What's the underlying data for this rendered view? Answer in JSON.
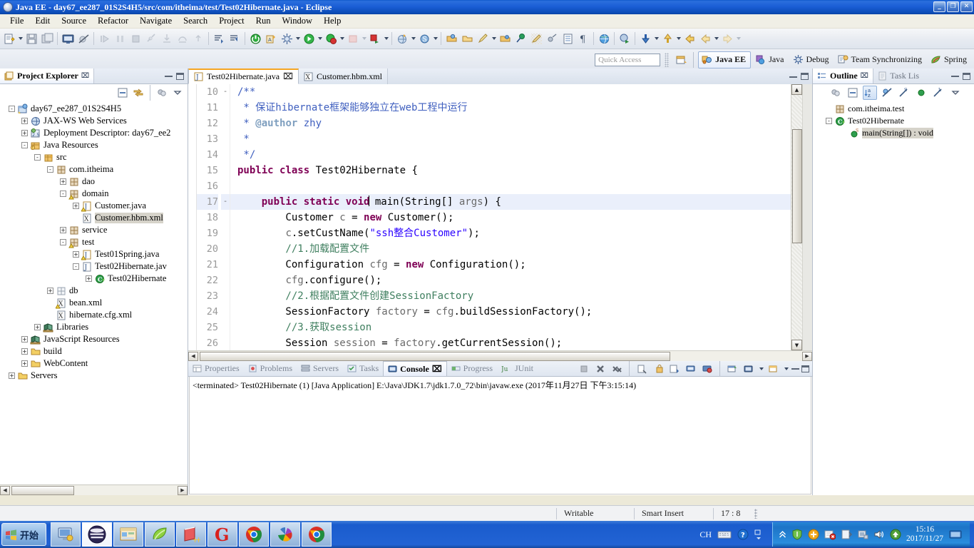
{
  "window": {
    "title": "Java EE - day67_ee287_01S2S4H5/src/com/itheima/test/Test02Hibernate.java - Eclipse",
    "minimize": "_",
    "restore": "❐",
    "close": "✕"
  },
  "menubar": {
    "items": [
      "File",
      "Edit",
      "Source",
      "Refactor",
      "Navigate",
      "Search",
      "Project",
      "Run",
      "Window",
      "Help"
    ]
  },
  "quick_access": {
    "placeholder": "Quick Access"
  },
  "perspectives": [
    {
      "label": "Java EE",
      "active": true
    },
    {
      "label": "Java",
      "active": false
    },
    {
      "label": "Debug",
      "active": false
    },
    {
      "label": "Team Synchronizing",
      "active": false
    },
    {
      "label": "Spring",
      "active": false
    }
  ],
  "project_explorer": {
    "tab_label": "Project Explorer",
    "close_glyph": "⌧",
    "tree": [
      {
        "indent": 0,
        "exp": "-",
        "icon": "project-icon",
        "label": "day67_ee287_01S2S4H5",
        "selected": false
      },
      {
        "indent": 1,
        "exp": "+",
        "icon": "jaxws-icon",
        "label": "JAX-WS Web Services",
        "selected": false
      },
      {
        "indent": 1,
        "exp": "+",
        "icon": "deployment-icon",
        "label": "Deployment Descriptor: day67_ee2",
        "selected": false
      },
      {
        "indent": 1,
        "exp": "-",
        "icon": "javaresources-icon",
        "label": "Java Resources",
        "selected": false
      },
      {
        "indent": 2,
        "exp": "-",
        "icon": "srcfolder-icon",
        "label": "src",
        "selected": false
      },
      {
        "indent": 3,
        "exp": "-",
        "icon": "package-icon",
        "label": "com.itheima",
        "selected": false
      },
      {
        "indent": 4,
        "exp": "+",
        "icon": "package-icon",
        "label": "dao",
        "selected": false
      },
      {
        "indent": 4,
        "exp": "-",
        "icon": "package-warn-icon",
        "label": "domain",
        "selected": false
      },
      {
        "indent": 5,
        "exp": "+",
        "icon": "java-warn-icon",
        "label": "Customer.java",
        "selected": false
      },
      {
        "indent": 5,
        "exp": "",
        "icon": "xml-icon",
        "label": "Customer.hbm.xml",
        "selected": true
      },
      {
        "indent": 4,
        "exp": "+",
        "icon": "package-icon",
        "label": "service",
        "selected": false
      },
      {
        "indent": 4,
        "exp": "-",
        "icon": "package-warn-icon",
        "label": "test",
        "selected": false
      },
      {
        "indent": 5,
        "exp": "+",
        "icon": "java-warn-icon",
        "label": "Test01Spring.java",
        "selected": false
      },
      {
        "indent": 5,
        "exp": "-",
        "icon": "java-icon",
        "label": "Test02Hibernate.jav",
        "selected": false
      },
      {
        "indent": 6,
        "exp": "+",
        "icon": "class-icon",
        "label": "Test02Hibernate",
        "selected": false
      },
      {
        "indent": 3,
        "exp": "+",
        "icon": "emptypkg-icon",
        "label": "db",
        "selected": false
      },
      {
        "indent": 3,
        "exp": "",
        "icon": "xml-warn-icon",
        "label": "bean.xml",
        "selected": false
      },
      {
        "indent": 3,
        "exp": "",
        "icon": "xml-icon",
        "label": "hibernate.cfg.xml",
        "selected": false
      },
      {
        "indent": 2,
        "exp": "+",
        "icon": "library-icon",
        "label": "Libraries",
        "selected": false
      },
      {
        "indent": 1,
        "exp": "+",
        "icon": "library-icon",
        "label": "JavaScript Resources",
        "selected": false
      },
      {
        "indent": 1,
        "exp": "+",
        "icon": "folder-icon",
        "label": "build",
        "selected": false
      },
      {
        "indent": 1,
        "exp": "+",
        "icon": "folder-icon",
        "label": "WebContent",
        "selected": false
      },
      {
        "indent": 0,
        "exp": "+",
        "icon": "folder-icon",
        "label": "Servers",
        "selected": false
      }
    ]
  },
  "editor": {
    "tabs": [
      {
        "label": "Test02Hibernate.java",
        "icon": "java-icon",
        "active": true,
        "close_glyph": "⌧"
      },
      {
        "label": "Customer.hbm.xml",
        "icon": "xml-icon",
        "active": false,
        "close_glyph": ""
      }
    ],
    "first_line_number": 10,
    "lines": [
      {
        "n": 10,
        "fold": "-",
        "hl": false,
        "tokens": [
          {
            "t": "/**",
            "c": "jdoc"
          }
        ]
      },
      {
        "n": 11,
        "fold": "",
        "hl": false,
        "tokens": [
          {
            "t": " * ",
            "c": "jdoc"
          },
          {
            "t": "保证hibernate框架能够独立在web工程中运行",
            "c": "jdoc"
          }
        ]
      },
      {
        "n": 12,
        "fold": "",
        "hl": false,
        "tokens": [
          {
            "t": " * ",
            "c": "jdoc"
          },
          {
            "t": "@author",
            "c": "jdoc-tag"
          },
          {
            "t": " zhy",
            "c": "jdoc"
          }
        ]
      },
      {
        "n": 13,
        "fold": "",
        "hl": false,
        "tokens": [
          {
            "t": " *",
            "c": "jdoc"
          }
        ]
      },
      {
        "n": 14,
        "fold": "",
        "hl": false,
        "tokens": [
          {
            "t": " */",
            "c": "jdoc"
          }
        ]
      },
      {
        "n": 15,
        "fold": "",
        "hl": false,
        "tokens": [
          {
            "t": "public class",
            "c": "kw"
          },
          {
            "t": " Test02Hibernate {",
            "c": ""
          }
        ]
      },
      {
        "n": 16,
        "fold": "",
        "hl": false,
        "tokens": [
          {
            "t": "",
            "c": ""
          }
        ]
      },
      {
        "n": 17,
        "fold": "-",
        "hl": true,
        "tokens": [
          {
            "t": "    ",
            "c": ""
          },
          {
            "t": "public static void",
            "c": "kw"
          },
          {
            "t": " main(String[] ",
            "c": ""
          },
          {
            "t": "args",
            "c": "local"
          },
          {
            "t": ") {",
            "c": ""
          }
        ]
      },
      {
        "n": 18,
        "fold": "",
        "hl": false,
        "tokens": [
          {
            "t": "        Customer ",
            "c": ""
          },
          {
            "t": "c",
            "c": "local"
          },
          {
            "t": " = ",
            "c": ""
          },
          {
            "t": "new",
            "c": "kw"
          },
          {
            "t": " Customer();",
            "c": ""
          }
        ]
      },
      {
        "n": 19,
        "fold": "",
        "hl": false,
        "tokens": [
          {
            "t": "        ",
            "c": ""
          },
          {
            "t": "c",
            "c": "local"
          },
          {
            "t": ".setCustName(",
            "c": ""
          },
          {
            "t": "\"ssh整合Customer\"",
            "c": "str"
          },
          {
            "t": ");",
            "c": ""
          }
        ]
      },
      {
        "n": 20,
        "fold": "",
        "hl": false,
        "tokens": [
          {
            "t": "        //1.加载配置文件",
            "c": "cmt"
          }
        ]
      },
      {
        "n": 21,
        "fold": "",
        "hl": false,
        "tokens": [
          {
            "t": "        Configuration ",
            "c": ""
          },
          {
            "t": "cfg",
            "c": "local"
          },
          {
            "t": " = ",
            "c": ""
          },
          {
            "t": "new",
            "c": "kw"
          },
          {
            "t": " Configuration();",
            "c": ""
          }
        ]
      },
      {
        "n": 22,
        "fold": "",
        "hl": false,
        "tokens": [
          {
            "t": "        ",
            "c": ""
          },
          {
            "t": "cfg",
            "c": "local"
          },
          {
            "t": ".configure();",
            "c": ""
          }
        ]
      },
      {
        "n": 23,
        "fold": "",
        "hl": false,
        "tokens": [
          {
            "t": "        //2.根据配置文件创建SessionFactory",
            "c": "cmt"
          }
        ]
      },
      {
        "n": 24,
        "fold": "",
        "hl": false,
        "tokens": [
          {
            "t": "        SessionFactory ",
            "c": ""
          },
          {
            "t": "factory",
            "c": "local"
          },
          {
            "t": " = ",
            "c": ""
          },
          {
            "t": "cfg",
            "c": "local"
          },
          {
            "t": ".buildSessionFactory();",
            "c": ""
          }
        ]
      },
      {
        "n": 25,
        "fold": "",
        "hl": false,
        "tokens": [
          {
            "t": "        //3.获取session",
            "c": "cmt"
          }
        ]
      },
      {
        "n": 26,
        "fold": "",
        "hl": false,
        "tokens": [
          {
            "t": "        Session ",
            "c": ""
          },
          {
            "t": "session",
            "c": "local"
          },
          {
            "t": " = ",
            "c": ""
          },
          {
            "t": "factory",
            "c": "local"
          },
          {
            "t": ".getCurrentSession();",
            "c": ""
          }
        ]
      }
    ]
  },
  "console": {
    "tabs": [
      {
        "label": "Properties",
        "icon": "properties-icon",
        "active": false
      },
      {
        "label": "Problems",
        "icon": "problems-icon",
        "active": false
      },
      {
        "label": "Servers",
        "icon": "servers-icon",
        "active": false
      },
      {
        "label": "Tasks",
        "icon": "tasks-icon",
        "active": false
      },
      {
        "label": "Console",
        "icon": "console-icon",
        "active": true,
        "close_glyph": "⌧"
      },
      {
        "label": "Progress",
        "icon": "progress-icon",
        "active": false
      },
      {
        "label": "JUnit",
        "icon": "junit-icon",
        "active": false
      }
    ],
    "output": "<terminated> Test02Hibernate (1) [Java Application] E:\\Java\\JDK1.7\\jdk1.7.0_72\\bin\\javaw.exe (2017年11月27日 下午3:15:14)"
  },
  "outline": {
    "tabs": [
      {
        "label": "Outline",
        "active": true,
        "close_glyph": "⌧"
      },
      {
        "label": "Task Lis",
        "active": false
      }
    ],
    "tree": [
      {
        "indent": 0,
        "exp": "",
        "icon": "package-icon",
        "label": "com.itheima.test",
        "selected": false
      },
      {
        "indent": 0,
        "exp": "-",
        "icon": "class-icon",
        "label": "Test02Hibernate",
        "selected": false
      },
      {
        "indent": 1,
        "exp": "",
        "icon": "method-static-icon",
        "label": "main(String[]) : void",
        "selected": true
      }
    ]
  },
  "statusbar": {
    "writable": "Writable",
    "insert_mode": "Smart Insert",
    "position": "17 : 8"
  },
  "taskbar": {
    "start_label": "开始",
    "quick_launch": [
      {
        "name": "show-desktop-icon",
        "active": false
      },
      {
        "name": "eclipse-icon",
        "active": true
      },
      {
        "name": "file-explorer-icon",
        "active": false
      },
      {
        "name": "leaf-app-icon",
        "active": false
      },
      {
        "name": "notepad-plus-icon",
        "active": false
      },
      {
        "name": "gold-g-icon",
        "active": false
      },
      {
        "name": "chrome-icon",
        "active": false
      },
      {
        "name": "pinwheel-icon",
        "active": false
      },
      {
        "name": "chrome2-icon",
        "active": false
      }
    ],
    "ime_label": "CH",
    "clock_time": "15:16",
    "clock_date": "2017/11/27"
  },
  "colors": {
    "title_blue": "#0b4bb5",
    "toolbar_bg": "#e7ebf1",
    "selection": "#d6d3ca",
    "line_highlight": "#eaeffb",
    "keyword": "#7f0055",
    "string": "#2a00ff",
    "comment": "#3f7f5f",
    "javadoc": "#3f5fbf",
    "tab_orange": "#f5a623"
  }
}
